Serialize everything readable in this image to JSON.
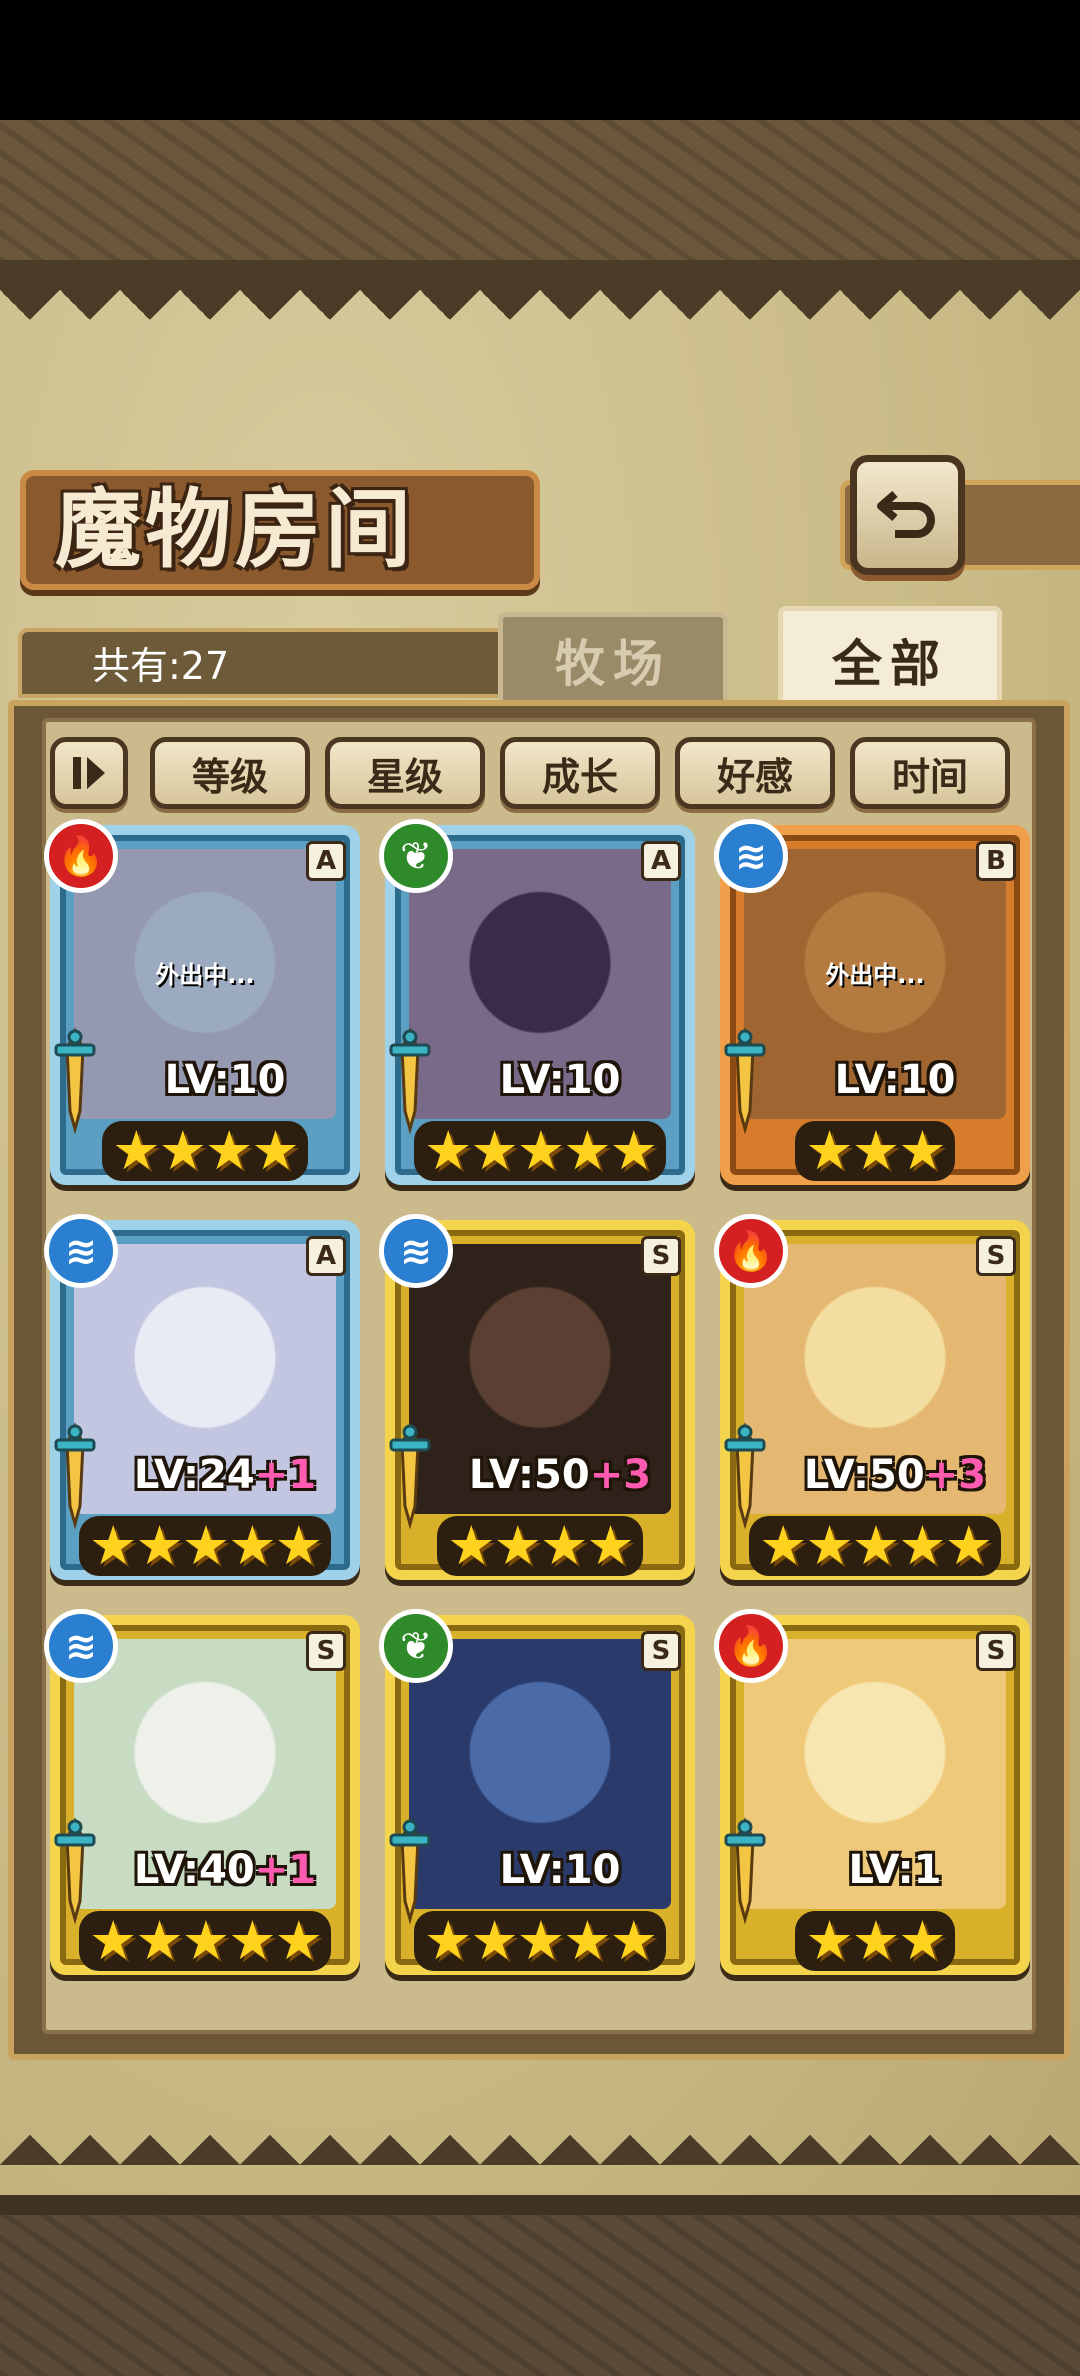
{
  "header": {
    "title": "魔物房间",
    "back_icon": "return-arrow-icon"
  },
  "count": {
    "text": "共有:27"
  },
  "tabs": [
    {
      "label": "牧场",
      "active": false
    },
    {
      "label": "全部",
      "active": true
    }
  ],
  "sort": {
    "toggle_icon": "sort-order-icon",
    "buttons": [
      "等级",
      "星级",
      "成长",
      "好感",
      "时间"
    ]
  },
  "colors": {
    "fire": "#d42020",
    "leaf": "#2f8a2a",
    "water": "#2a7fd0",
    "frameA": "#9fd2e8",
    "frameB": "#f0a04a",
    "frameS": "#f3d44c"
  },
  "monsters": [
    {
      "element": "fire",
      "rank": "A",
      "level": "LV:10",
      "bonus": "",
      "stars": "★★★★",
      "status": "外出中..."
    },
    {
      "element": "leaf",
      "rank": "A",
      "level": "LV:10",
      "bonus": "",
      "stars": "★★★★★",
      "status": ""
    },
    {
      "element": "water",
      "rank": "B",
      "level": "LV:10",
      "bonus": "",
      "stars": "★★★",
      "status": "外出中..."
    },
    {
      "element": "water",
      "rank": "A",
      "level": "LV:24",
      "bonus": "+1",
      "stars": "★★★★★",
      "status": ""
    },
    {
      "element": "water",
      "rank": "S",
      "level": "LV:50",
      "bonus": "+3",
      "stars": "★★★★",
      "status": ""
    },
    {
      "element": "fire",
      "rank": "S",
      "level": "LV:50",
      "bonus": "+3",
      "stars": "★★★★★",
      "status": ""
    },
    {
      "element": "water",
      "rank": "S",
      "level": "LV:40",
      "bonus": "+1",
      "stars": "★★★★★",
      "status": ""
    },
    {
      "element": "leaf",
      "rank": "S",
      "level": "LV:10",
      "bonus": "",
      "stars": "★★★★★",
      "status": ""
    },
    {
      "element": "fire",
      "rank": "S",
      "level": "LV:1",
      "bonus": "",
      "stars": "★★★",
      "status": ""
    }
  ]
}
